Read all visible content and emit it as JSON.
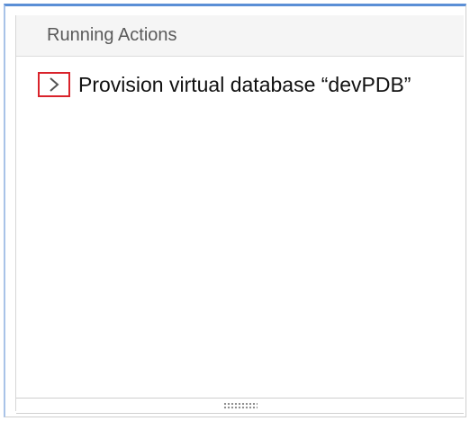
{
  "panel": {
    "title": "Running Actions"
  },
  "actions": [
    {
      "label": "Provision virtual database “devPDB”",
      "toggle_icon": "chevron-right-icon"
    }
  ],
  "colors": {
    "frame_accent": "#5b8fd6",
    "highlight_border": "#d9232b",
    "header_background": "#f5f5f5",
    "title_text": "#5a5a5a"
  }
}
